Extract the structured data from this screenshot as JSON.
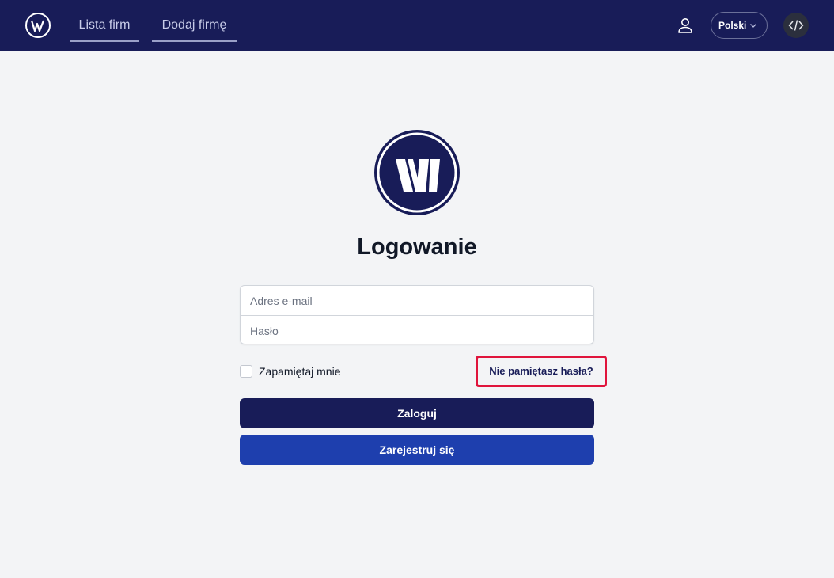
{
  "header": {
    "nav": [
      {
        "label": "Lista firm"
      },
      {
        "label": "Dodaj firmę"
      }
    ],
    "language": "Polski",
    "icons": {
      "logo": "brand-w-logo-icon",
      "user": "user-icon",
      "language_chevron": "chevron-down-icon",
      "developer": "code-icon"
    },
    "colors": {
      "background": "#181c58"
    }
  },
  "login": {
    "title": "Logowanie",
    "email_placeholder": "Adres e-mail",
    "password_placeholder": "Hasło",
    "remember_label": "Zapamiętaj mnie",
    "remember_checked": false,
    "forgot_label": "Nie pamiętasz hasła?",
    "login_button": "Zaloguj",
    "register_button": "Zarejestruj się"
  },
  "colors": {
    "primary": "#181c58",
    "secondary": "#1e3fae",
    "highlight": "#e0143c",
    "page_background": "#f3f4f6"
  }
}
